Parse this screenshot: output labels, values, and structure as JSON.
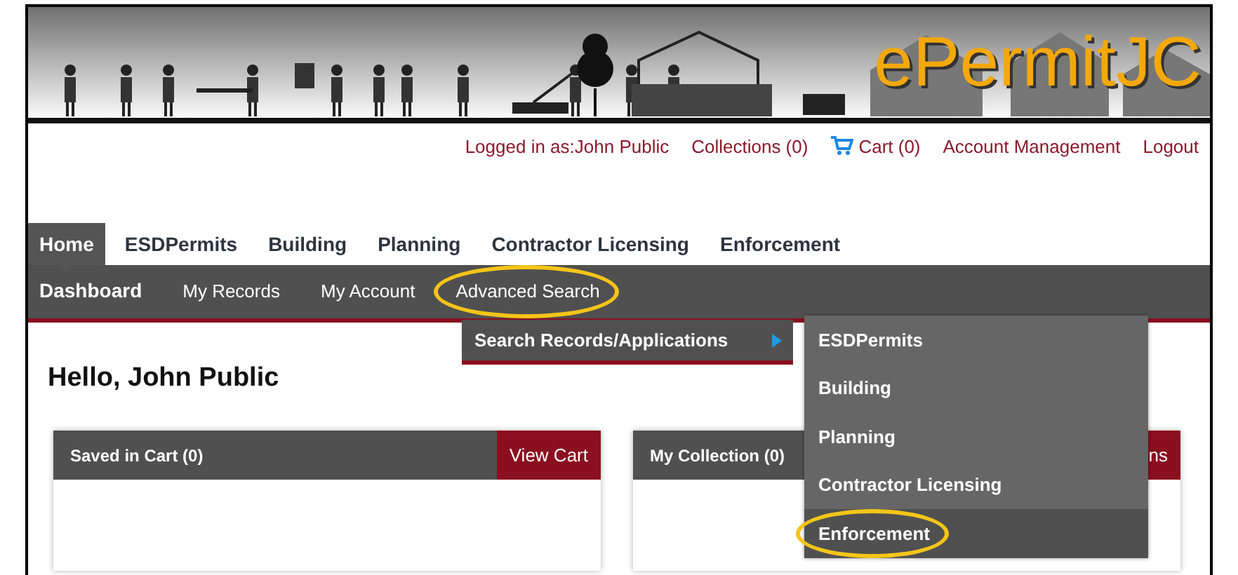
{
  "banner": {
    "logo": "ePermitJC"
  },
  "user_links": [
    {
      "label": "Logged in as:John Public",
      "kind": "text"
    },
    {
      "label": "Collections (0)",
      "kind": "link"
    },
    {
      "label": "Cart (0)",
      "kind": "cart"
    },
    {
      "label": "Account Management",
      "kind": "link"
    },
    {
      "label": "Logout",
      "kind": "link"
    }
  ],
  "main_nav": [
    {
      "label": "Home",
      "selected": true
    },
    {
      "label": "ESDPermits",
      "selected": false
    },
    {
      "label": "Building",
      "selected": false
    },
    {
      "label": "Planning",
      "selected": false
    },
    {
      "label": "Contractor Licensing",
      "selected": false
    },
    {
      "label": "Enforcement",
      "selected": false
    }
  ],
  "sub_nav": [
    {
      "label": "Dashboard",
      "selected": true,
      "highlighted": false
    },
    {
      "label": "My Records",
      "selected": false,
      "highlighted": false
    },
    {
      "label": "My Account",
      "selected": false,
      "highlighted": false
    },
    {
      "label": "Advanced Search",
      "selected": false,
      "highlighted": true
    }
  ],
  "dropdown": {
    "items": [
      {
        "label": "Search Records/Applications",
        "expanded": true
      }
    ]
  },
  "submenu": {
    "items": [
      {
        "label": "ESDPermits",
        "selected": false,
        "highlighted": false
      },
      {
        "label": "Building",
        "selected": false,
        "highlighted": false
      },
      {
        "label": "Planning",
        "selected": false,
        "highlighted": false
      },
      {
        "label": "Contractor Licensing",
        "selected": false,
        "highlighted": false
      },
      {
        "label": "Enforcement",
        "selected": true,
        "highlighted": true
      }
    ]
  },
  "greeting": "Hello, John Public",
  "cards": [
    {
      "title": "Saved in Cart (0)",
      "button": "View Cart"
    },
    {
      "title": "My Collection (0)",
      "button": "ns"
    }
  ]
}
